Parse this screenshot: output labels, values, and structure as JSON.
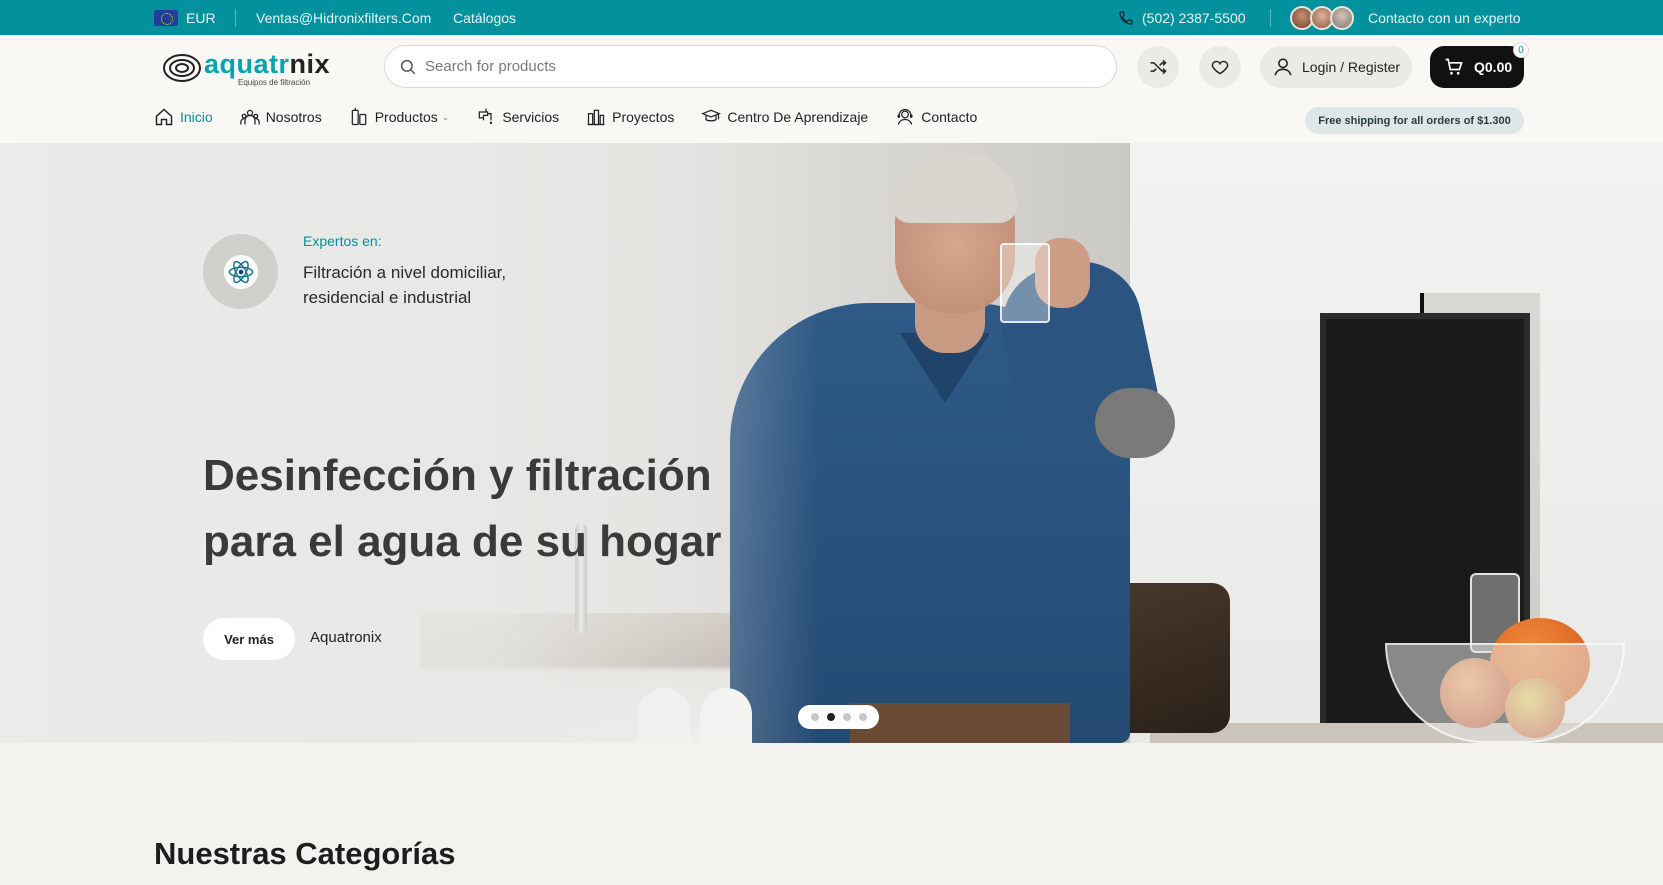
{
  "topbar": {
    "currency": "EUR",
    "email": "Ventas@Hidronixfilters.Com",
    "catalogs": "Catálogos",
    "phone": "(502) 2387-5500",
    "expert": "Contacto con un experto"
  },
  "header": {
    "logo_text_a": "aquatr",
    "logo_text_b": "nix",
    "logo_tagline": "Equipos de filtración",
    "search_placeholder": "Search for products",
    "login": "Login / Register",
    "cart_total": "Q0.00",
    "cart_count": "0"
  },
  "nav": {
    "items": [
      {
        "label": "Inicio",
        "icon": "home-icon"
      },
      {
        "label": "Nosotros",
        "icon": "team-icon"
      },
      {
        "label": "Productos",
        "icon": "filter-icon"
      },
      {
        "label": "Servicios",
        "icon": "tap-icon"
      },
      {
        "label": "Proyectos",
        "icon": "plant-icon"
      },
      {
        "label": "Centro De Aprendizaje",
        "icon": "graduation-icon"
      },
      {
        "label": "Contacto",
        "icon": "support-icon"
      }
    ],
    "shipping": "Free shipping for all orders of $1.300"
  },
  "hero": {
    "expert_label": "Expertos en:",
    "expert_text": "Filtración a nivel domiciliar, residencial e industrial",
    "title": "Desinfección y filtración para el agua de su hogar",
    "button": "Ver más",
    "brand_link": "Aquatronix",
    "slides": 4,
    "active_slide": 2
  },
  "section": {
    "title": "Nuestras Categorías"
  },
  "colors": {
    "accent": "#02919d",
    "topbar_bg": "#02919d",
    "cart_bg": "#111111"
  }
}
